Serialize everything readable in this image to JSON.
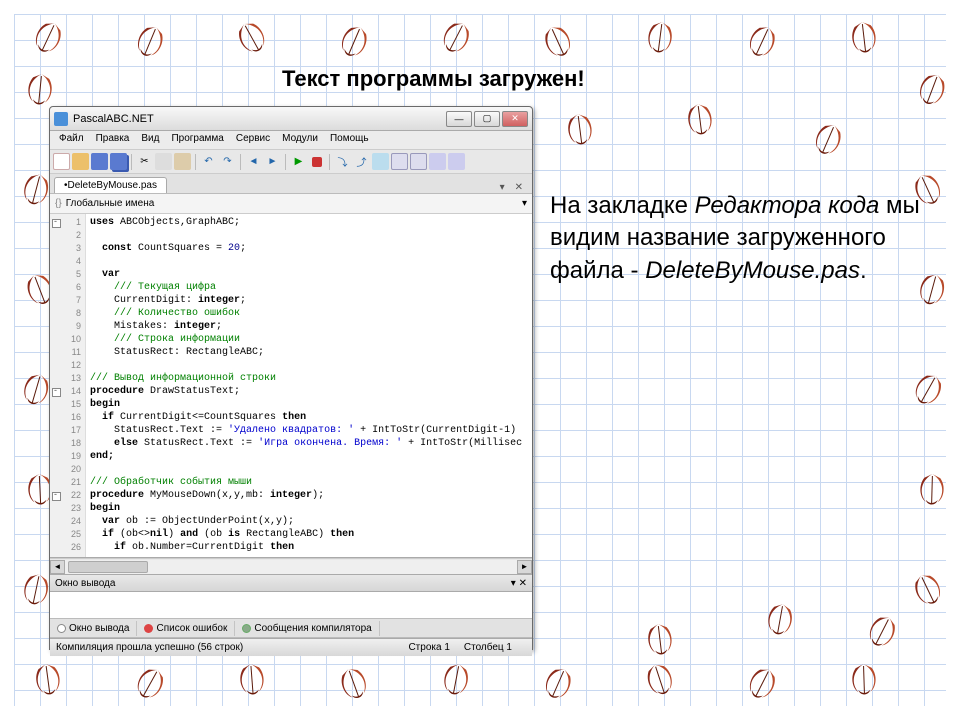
{
  "slide": {
    "title": "Текст программы загружен!",
    "side1": "На закладке ",
    "side2": "Редактора кода",
    "side3": " мы видим название загруженного файла - ",
    "side4": "DeleteByMouse.pas",
    "side5": "."
  },
  "window": {
    "title": "PascalABC.NET",
    "min": "—",
    "max": "▢",
    "close": "✕"
  },
  "menu": [
    "Файл",
    "Правка",
    "Вид",
    "Программа",
    "Сервис",
    "Модули",
    "Помощь"
  ],
  "tab": {
    "name": "•DeleteByMouse.pas",
    "down": "▾",
    "x": "✕"
  },
  "dropdown": {
    "label": "Глобальные имена",
    "arrow": "▾"
  },
  "gutter": [
    "1",
    "2",
    "3",
    "4",
    "5",
    "6",
    "7",
    "8",
    "9",
    "10",
    "11",
    "12",
    "13",
    "14",
    "15",
    "16",
    "17",
    "18",
    "19",
    "20",
    "21",
    "22",
    "23",
    "24",
    "25",
    "26"
  ],
  "code": {
    "l1a": "uses ",
    "l1b": "ABCObjects,GraphABC;",
    "l3a": "const ",
    "l3b": "CountSquares = ",
    "l3c": "20",
    "l3d": ";",
    "l5": "var",
    "l6": "/// Текущая цифра",
    "l7a": "CurrentDigit: ",
    "l7b": "integer",
    "l7c": ";",
    "l8": "/// Количество ошибок",
    "l9a": "Mistakes: ",
    "l9b": "integer",
    "l9c": ";",
    "l10": "/// Строка информации",
    "l11": "StatusRect: RectangleABC;",
    "l13": "/// Вывод информационной строки",
    "l14a": "procedure ",
    "l14b": "DrawStatusText;",
    "l15": "begin",
    "l16a": "if ",
    "l16b": "CurrentDigit<=CountSquares ",
    "l16c": "then",
    "l17a": "StatusRect.Text := ",
    "l17b": "'Удалено квадратов: '",
    "l17c": " + IntToStr(CurrentDigit-1)",
    "l18a": "else ",
    "l18b": "StatusRect.Text := ",
    "l18c": "'Игра окончена. Время: '",
    "l18d": " + IntToStr(Millisec",
    "l19": "end;",
    "l21": "/// Обработчик события мыши",
    "l22a": "procedure ",
    "l22b": "MyMouseDown(x,y,mb: ",
    "l22c": "integer",
    "l22d": ");",
    "l23": "begin",
    "l24a": "var ",
    "l24b": "ob := ObjectUnderPoint(x,y);",
    "l25a": "if ",
    "l25b": "(ob<>",
    "l25c": "nil",
    "l25d": ") ",
    "l25e": "and ",
    "l25f": "(ob ",
    "l25g": "is ",
    "l25h": "RectangleABC) ",
    "l25i": "then",
    "l26a": "if ",
    "l26b": "ob.Number=CurrentDigit ",
    "l26c": "then"
  },
  "output": {
    "title": "Окно вывода",
    "pin": "▾",
    "x": "✕"
  },
  "ptabs": {
    "a": "Окно вывода",
    "b": "Список ошибок",
    "c": "Сообщения компилятора"
  },
  "status": {
    "msg": "Компиляция прошла успешно (56 строк)",
    "line": "Строка  1",
    "col": "Столбец  1"
  }
}
